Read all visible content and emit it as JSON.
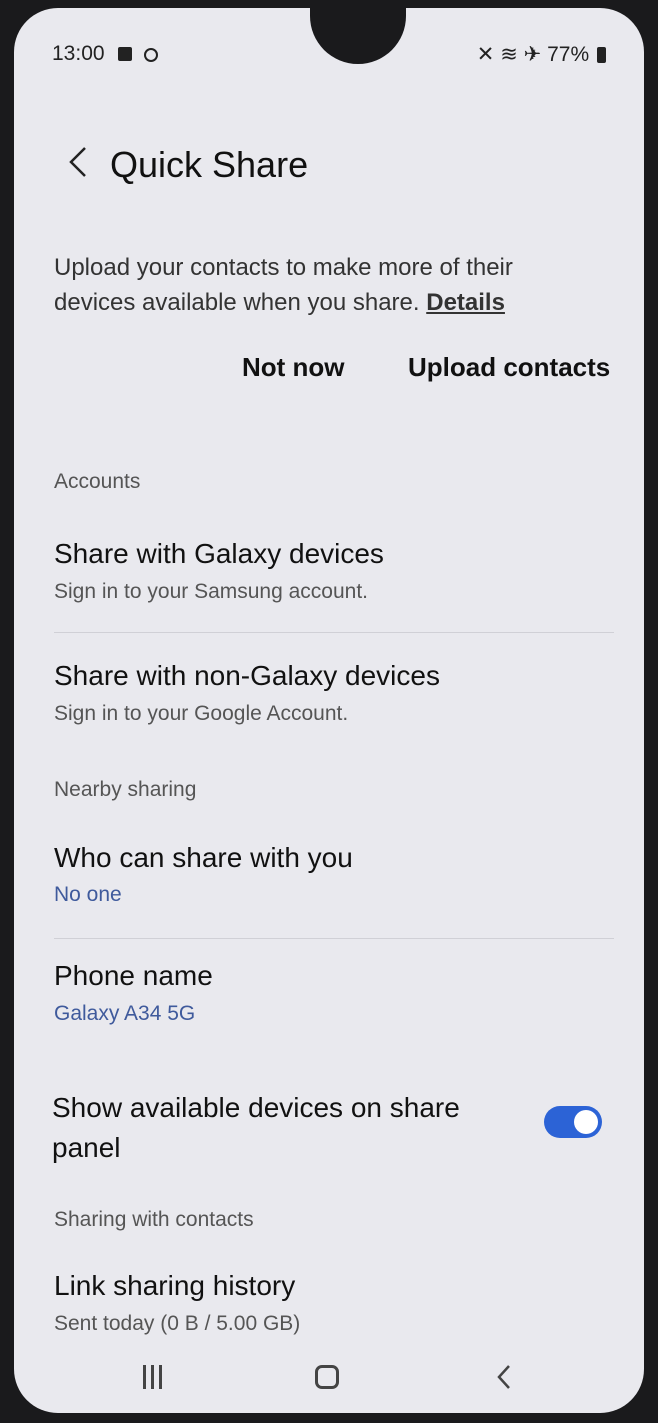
{
  "status": {
    "time": "13:00",
    "battery": "77%"
  },
  "header": {
    "title": "Quick Share"
  },
  "upload": {
    "text": "Upload your contacts to make more of their devices available when you share.",
    "link": "Details",
    "not_now": "Not now",
    "upload_contacts": "Upload contacts"
  },
  "accounts": {
    "label": "Accounts",
    "items": [
      {
        "title": "Share with Galaxy devices",
        "subtitle": "Sign in to your Samsung account."
      },
      {
        "title": "Share with non-Galaxy devices",
        "subtitle": "Sign in to your Google Account."
      }
    ]
  },
  "nearby": {
    "label": "Nearby sharing",
    "who": {
      "title": "Who can share with you",
      "value": "No one"
    },
    "phone": {
      "title": "Phone name",
      "value": "Galaxy A34 5G"
    },
    "show_devices": {
      "title": "Show available devices on share panel",
      "enabled": true
    }
  },
  "contacts": {
    "label": "Sharing with contacts",
    "history": {
      "title": "Link sharing history",
      "subtitle": "Sent today (0 B / 5.00 GB)"
    }
  },
  "colors": {
    "accent": "#2c63d6",
    "background": "#e9e9ee"
  }
}
